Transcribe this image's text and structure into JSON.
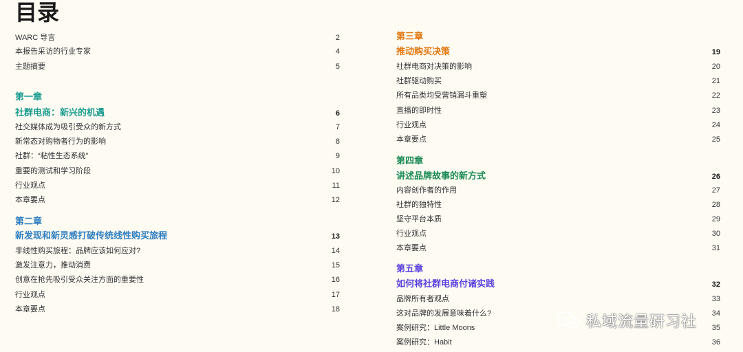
{
  "page_title": "目录",
  "colors": {
    "teal": "#1a9c8f",
    "blue": "#2f7fc0",
    "orange": "#e2770f",
    "green": "#1a8a55",
    "violet": "#5b3fe0"
  },
  "left": {
    "intro": [
      {
        "title": "WARC 导言",
        "page": "2"
      },
      {
        "title": "本报告采访的行业专家",
        "page": "4"
      },
      {
        "title": "主题摘要",
        "page": "5"
      }
    ],
    "chapters": [
      {
        "label": "第一章",
        "heading": "社群电商：新兴的机遇",
        "page": "6",
        "color": "#1a9c8f",
        "items": [
          {
            "title": "社交媒体成为吸引受众的新方式",
            "page": "7"
          },
          {
            "title": "新常态对购物者行为的影响",
            "page": "8"
          },
          {
            "title": "社群：“粘性生态系统”",
            "page": "9"
          },
          {
            "title": "重要的测试和学习阶段",
            "page": "10"
          },
          {
            "title": "行业观点",
            "page": "11"
          },
          {
            "title": "本章要点",
            "page": "12"
          }
        ]
      },
      {
        "label": "第二章",
        "heading": "新发现和新灵感打破传统线性购买旅程",
        "page": "13",
        "color": "#2f7fc0",
        "items": [
          {
            "title": "非线性购买旅程：品牌应该如何应对?",
            "page": "14"
          },
          {
            "title": "激发注意力，推动消费",
            "page": "15"
          },
          {
            "title": "创意在抢先吸引受众关注方面的重要性",
            "page": "16"
          },
          {
            "title": "行业观点",
            "page": "17"
          },
          {
            "title": "本章要点",
            "page": "18"
          }
        ]
      }
    ]
  },
  "right": {
    "chapters": [
      {
        "label": "第三章",
        "heading": "推动购买决策",
        "page": "19",
        "color": "#e2770f",
        "items": [
          {
            "title": "社群电商对决策的影响",
            "page": "20"
          },
          {
            "title": "社群驱动购买",
            "page": "21"
          },
          {
            "title": "所有品类均受营销漏斗重塑",
            "page": "22"
          },
          {
            "title": "直播的即时性",
            "page": "23"
          },
          {
            "title": "行业观点",
            "page": "24"
          },
          {
            "title": "本章要点",
            "page": "25"
          }
        ]
      },
      {
        "label": "第四章",
        "heading": "讲述品牌故事的新方式",
        "page": "26",
        "color": "#1a8a55",
        "items": [
          {
            "title": "内容创作者的作用",
            "page": "27"
          },
          {
            "title": "社群的独特性",
            "page": "28"
          },
          {
            "title": "坚守平台本质",
            "page": "29"
          },
          {
            "title": "行业观点",
            "page": "30"
          },
          {
            "title": "本章要点",
            "page": "31"
          }
        ]
      },
      {
        "label": "第五章",
        "heading": "如何将社群电商付诸实践",
        "page": "32",
        "color": "#5b3fe0",
        "items": [
          {
            "title": "品牌所有者观点",
            "page": "33"
          },
          {
            "title": "这对品牌的发展意味着什么?",
            "page": "34"
          },
          {
            "title": "案例研究：Little Moons",
            "page": "35"
          },
          {
            "title": "案例研究：Habit",
            "page": "36"
          }
        ]
      }
    ]
  },
  "watermark": {
    "text": "私域流量研习社",
    "icon": "wechat-icon"
  }
}
